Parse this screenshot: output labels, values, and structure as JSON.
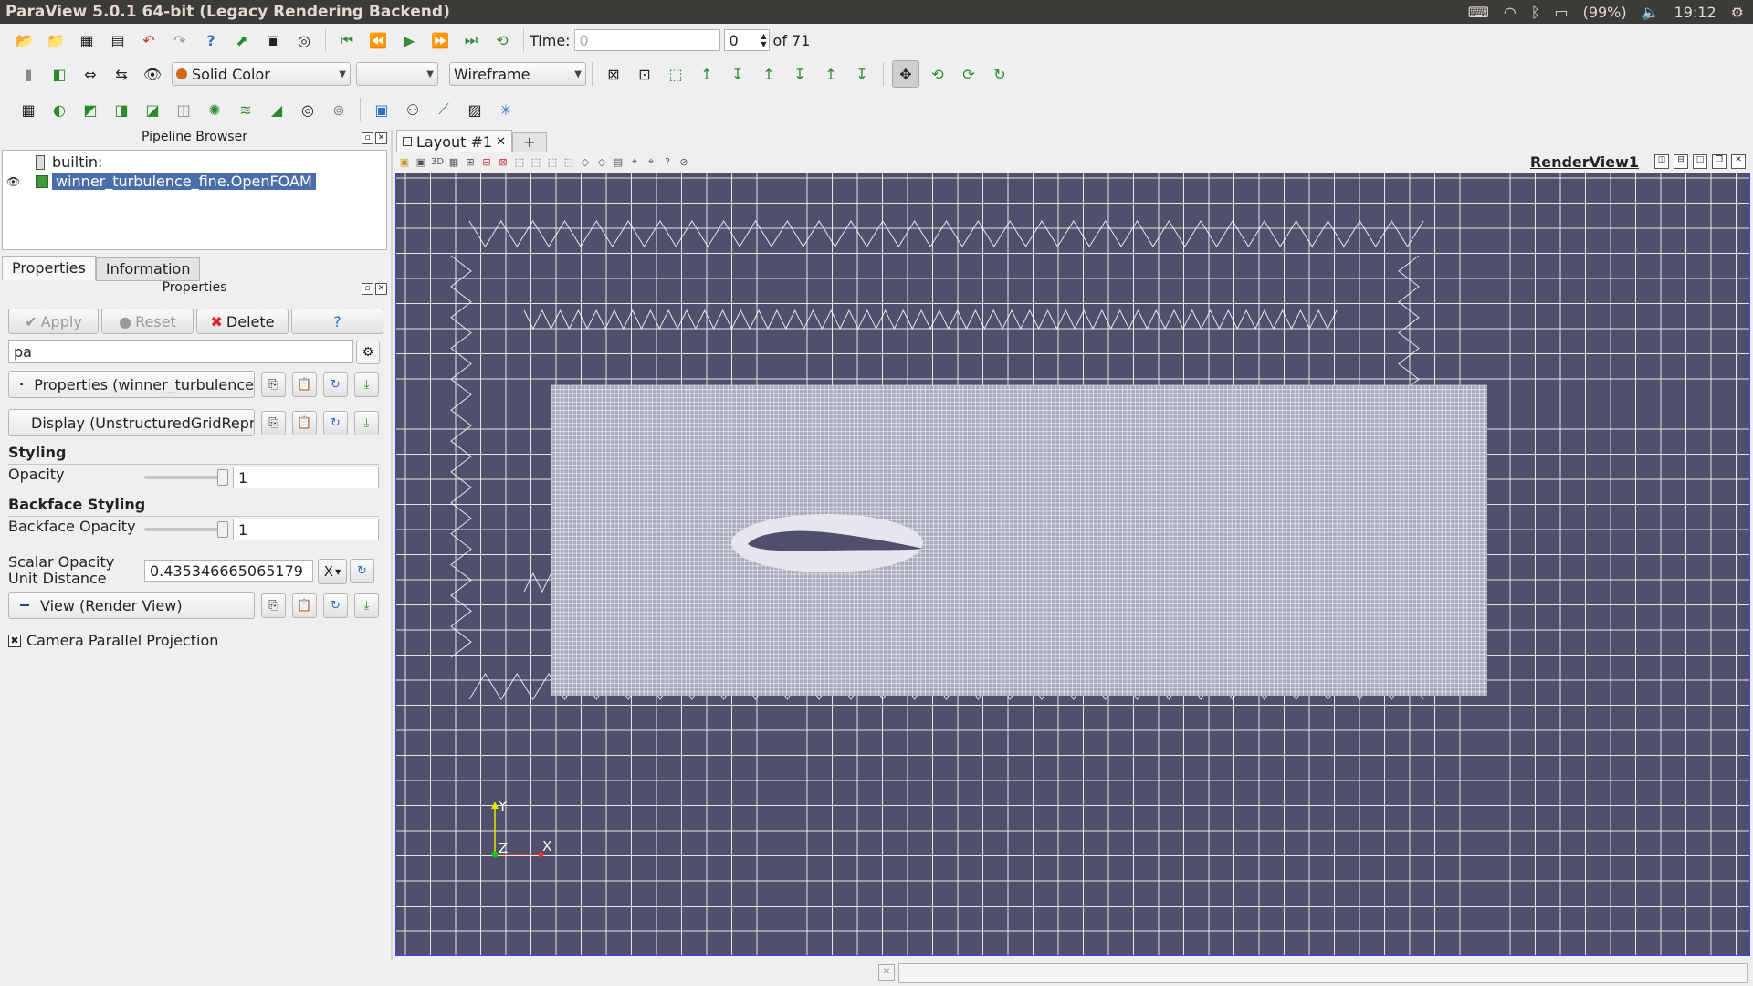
{
  "window": {
    "title": "ParaView 5.0.1 64-bit (Legacy Rendering Backend)"
  },
  "tray": {
    "battery": "(99%)",
    "clock": "19:12"
  },
  "time_toolbar": {
    "time_label": "Time:",
    "time_value": "0",
    "timestep": "0",
    "of_label": "of 71"
  },
  "display_toolbar": {
    "color_by": "Solid Color",
    "component": "",
    "representation": "Wireframe"
  },
  "pipeline_browser": {
    "title": "Pipeline Browser",
    "items": [
      {
        "label": "builtin:"
      },
      {
        "label": "winner_turbulence_fine.OpenFOAM"
      }
    ]
  },
  "tabs": {
    "properties": "Properties",
    "information": "Information"
  },
  "properties_panel": {
    "title": "Properties",
    "apply": "Apply",
    "reset": "Reset",
    "delete": "Delete",
    "help": "?",
    "search_value": "pa",
    "section_properties": "Properties (winner_turbulence",
    "section_display": "Display (UnstructuredGridRepr",
    "styling_heading": "Styling",
    "opacity_label": "Opacity",
    "opacity_value": "1",
    "opacity_fraction": 1.0,
    "backface_heading": "Backface Styling",
    "backface_opacity_label": "Backface Opacity",
    "backface_opacity_value": "1",
    "backface_fraction": 1.0,
    "scalar_label_1": "Scalar Opacity",
    "scalar_label_2": "Unit Distance",
    "scalar_value": "0.435346665065179",
    "scalar_axis": "X",
    "section_view": "View (Render View)",
    "camera_parallel": "Camera Parallel Projection"
  },
  "layout": {
    "tab_label": "Layout #1",
    "add_tab": "+",
    "view_name": "RenderView1",
    "view_3d": "3D"
  },
  "render": {
    "background": "#4f506c",
    "mesh_color": "#ffffff",
    "axis_y": "Y",
    "axis_z": "Z",
    "axis_x": "X"
  }
}
